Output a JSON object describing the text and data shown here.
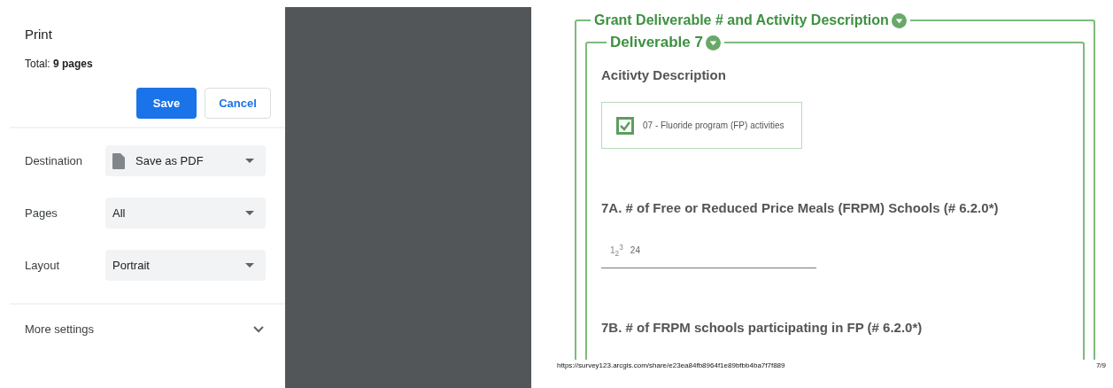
{
  "print_panel": {
    "title": "Print",
    "total": "Total: **9 pages**",
    "buttons": [
      {
        "label": "Save",
        "kind": "primary"
      },
      {
        "label": "Cancel",
        "kind": "secondary"
      }
    ],
    "settings": [
      {
        "label": "Destination",
        "value": "Save as PDF",
        "kind": "file-select"
      },
      {
        "label": "Pages",
        "value": "All",
        "kind": "select"
      },
      {
        "label": "Layout",
        "value": "Portrait",
        "kind": "select"
      }
    ],
    "more_settings": {
      "label": "More settings",
      "expanded": false
    }
  },
  "document": {
    "group": {
      "title": "Grant Deliverable # and Activity Description",
      "expanded": true,
      "subgroup": {
        "title": "Deliverable 7",
        "expanded": true,
        "questions": [
          {
            "kind": "choice",
            "label": "Acitivty Description",
            "option": {
              "label": "07 - Fluoride program (FP) activities",
              "checked": true
            }
          },
          {
            "kind": "number",
            "label": "7A. # of Free or Reduced Price Meals (FRPM) Schools (# 6.2.0*)",
            "value": "24",
            "type_marker": "1$_{2}$$^{3}$"
          },
          {
            "kind": "number",
            "label": "7B. # of FRPM schools participating in FP (# 6.2.0*)"
          }
        ]
      }
    }
  },
  "footer": {
    "url": "https://survey123.arcgis.com/share/e23ea84fb8964f1e89bfbb4ba7f7f889",
    "page": "7/9"
  }
}
